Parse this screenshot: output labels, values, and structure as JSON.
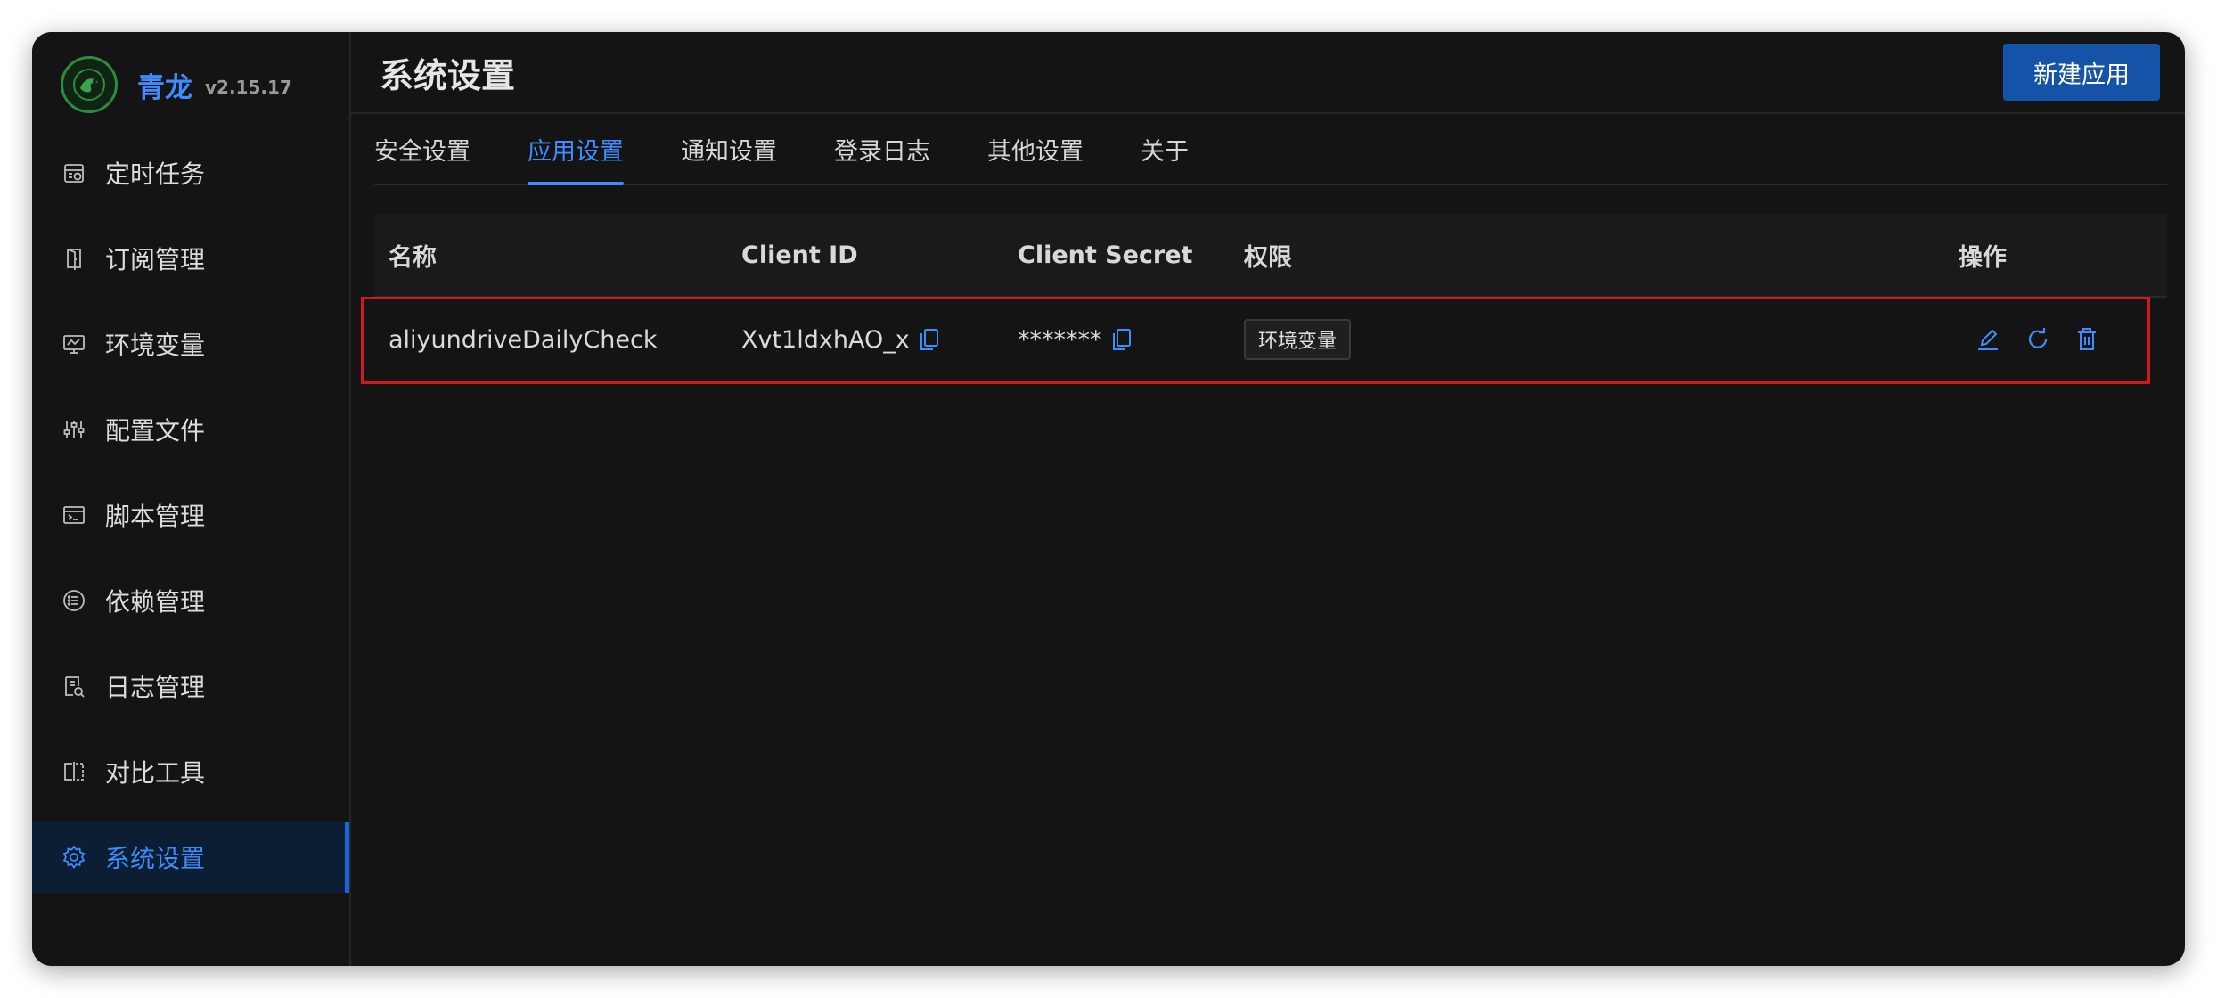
{
  "app": {
    "name": "青龙",
    "version": "v2.15.17"
  },
  "sidebar": {
    "items": [
      {
        "label": "定时任务",
        "icon": "calendar-clock-icon"
      },
      {
        "label": "订阅管理",
        "icon": "subscription-door-icon"
      },
      {
        "label": "环境变量",
        "icon": "monitor-icon"
      },
      {
        "label": "配置文件",
        "icon": "sliders-icon"
      },
      {
        "label": "脚本管理",
        "icon": "terminal-icon"
      },
      {
        "label": "依赖管理",
        "icon": "list-circle-icon"
      },
      {
        "label": "日志管理",
        "icon": "log-file-icon"
      },
      {
        "label": "对比工具",
        "icon": "split-compare-icon"
      },
      {
        "label": "系统设置",
        "icon": "gear-icon",
        "active": true
      }
    ]
  },
  "header": {
    "title": "系统设置",
    "new_app_label": "新建应用"
  },
  "tabs": [
    {
      "label": "安全设置"
    },
    {
      "label": "应用设置",
      "active": true
    },
    {
      "label": "通知设置"
    },
    {
      "label": "登录日志"
    },
    {
      "label": "其他设置"
    },
    {
      "label": "关于"
    }
  ],
  "table": {
    "columns": [
      "名称",
      "Client ID",
      "Client Secret",
      "权限",
      "操作"
    ],
    "rows": [
      {
        "name": "aliyundriveDailyCheck",
        "client_id": "Xvt1ldxhAO_x",
        "client_secret": "*******",
        "permission": "环境变量"
      }
    ]
  },
  "colors": {
    "accent": "#3f8cff",
    "primary_button": "#1453a8",
    "highlight_border": "#d01822",
    "background": "#141414"
  }
}
